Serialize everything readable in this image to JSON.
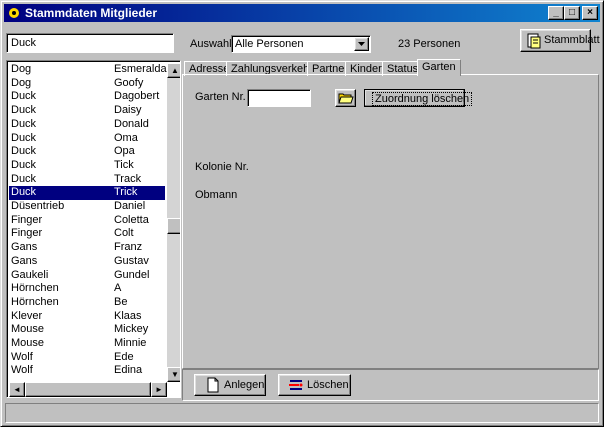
{
  "window": {
    "title": "Stammdaten Mitglieder",
    "minimize_glyph": "_",
    "maximize_glyph": "□",
    "close_glyph": "×"
  },
  "toolbar": {
    "search_value": "Duck",
    "auswahl_label": "Auswahl",
    "auswahl_selected": "Alle Personen",
    "count_text": "23 Personen",
    "stammblatt_label": "Stammblatt"
  },
  "list": {
    "selected_index": 9,
    "rows": [
      {
        "name": "Dog",
        "first": "Esmeralda"
      },
      {
        "name": "Dog",
        "first": "Goofy"
      },
      {
        "name": "Duck",
        "first": "Dagobert"
      },
      {
        "name": "Duck",
        "first": "Daisy"
      },
      {
        "name": "Duck",
        "first": "Donald"
      },
      {
        "name": "Duck",
        "first": "Oma"
      },
      {
        "name": "Duck",
        "first": "Opa"
      },
      {
        "name": "Duck",
        "first": "Tick"
      },
      {
        "name": "Duck",
        "first": "Track"
      },
      {
        "name": "Duck",
        "first": "Trick"
      },
      {
        "name": "Düsentrieb",
        "first": "Daniel"
      },
      {
        "name": "Finger",
        "first": "Coletta"
      },
      {
        "name": "Finger",
        "first": "Colt"
      },
      {
        "name": "Gans",
        "first": "Franz"
      },
      {
        "name": "Gans",
        "first": "Gustav"
      },
      {
        "name": "Gaukeli",
        "first": "Gundel"
      },
      {
        "name": "Hörnchen",
        "first": "A"
      },
      {
        "name": "Hörnchen",
        "first": "Be"
      },
      {
        "name": "Klever",
        "first": "Klaas"
      },
      {
        "name": "Mouse",
        "first": "Mickey"
      },
      {
        "name": "Mouse",
        "first": "Minnie"
      },
      {
        "name": "Wolf",
        "first": "Ede"
      },
      {
        "name": "Wolf",
        "first": "Edina"
      }
    ]
  },
  "tabs": [
    {
      "label": "Adresse"
    },
    {
      "label": "Zahlungsverkehr"
    },
    {
      "label": "Partner"
    },
    {
      "label": "Kinder"
    },
    {
      "label": "Status"
    },
    {
      "label": "Garten",
      "active": true
    }
  ],
  "garten": {
    "garten_nr_label": "Garten Nr.",
    "garten_nr_value": "",
    "zuordnung_label": "Zuordnung löschen",
    "kolonie_label": "Kolonie Nr.",
    "obmann_label": "Obmann"
  },
  "actions": {
    "anlegen_label": "Anlegen",
    "loeschen_label": "Löschen"
  },
  "colors": {
    "title_bar": "#000080",
    "selection": "#000080",
    "face": "#c0c0c0"
  }
}
